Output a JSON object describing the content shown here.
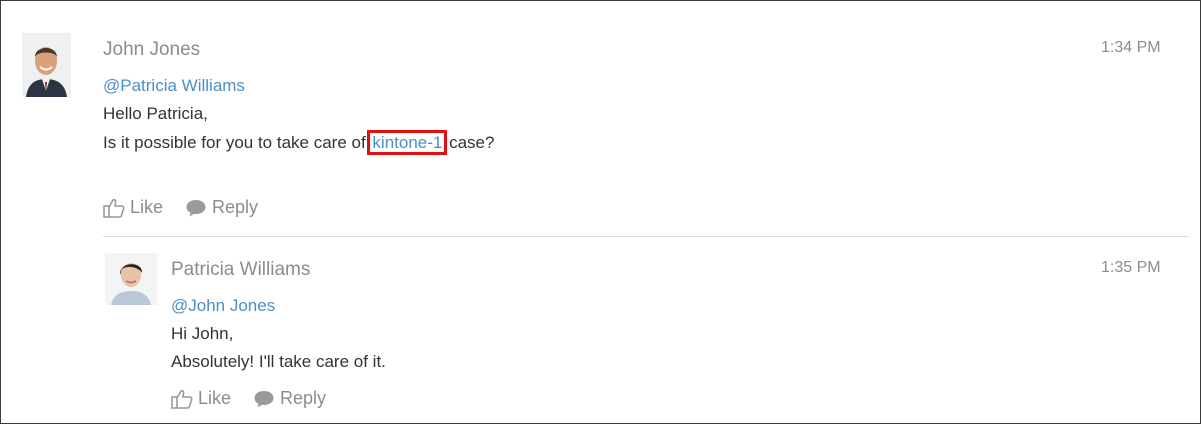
{
  "thread": {
    "comment": {
      "author": "John Jones",
      "time": "1:34 PM",
      "mention": "@Patricia Williams",
      "line1": "Hello Patricia,",
      "line2_before": "Is it possible for you to take care of ",
      "line2_link": "kintone-1",
      "line2_after": " case?",
      "like_label": "Like",
      "reply_label": "Reply"
    },
    "reply": {
      "author": "Patricia Williams",
      "time": "1:35 PM",
      "mention": "@John Jones",
      "line1": "Hi John,",
      "line2": "Absolutely! I'll take care of it.",
      "like_label": "Like",
      "reply_label": "Reply"
    }
  },
  "colors": {
    "link": "#4a90c8",
    "meta": "#8c8c8c",
    "text": "#333333",
    "highlight": "#e01010"
  },
  "icons": {
    "like": "thumbs-up-icon",
    "reply": "speech-bubble-icon"
  }
}
